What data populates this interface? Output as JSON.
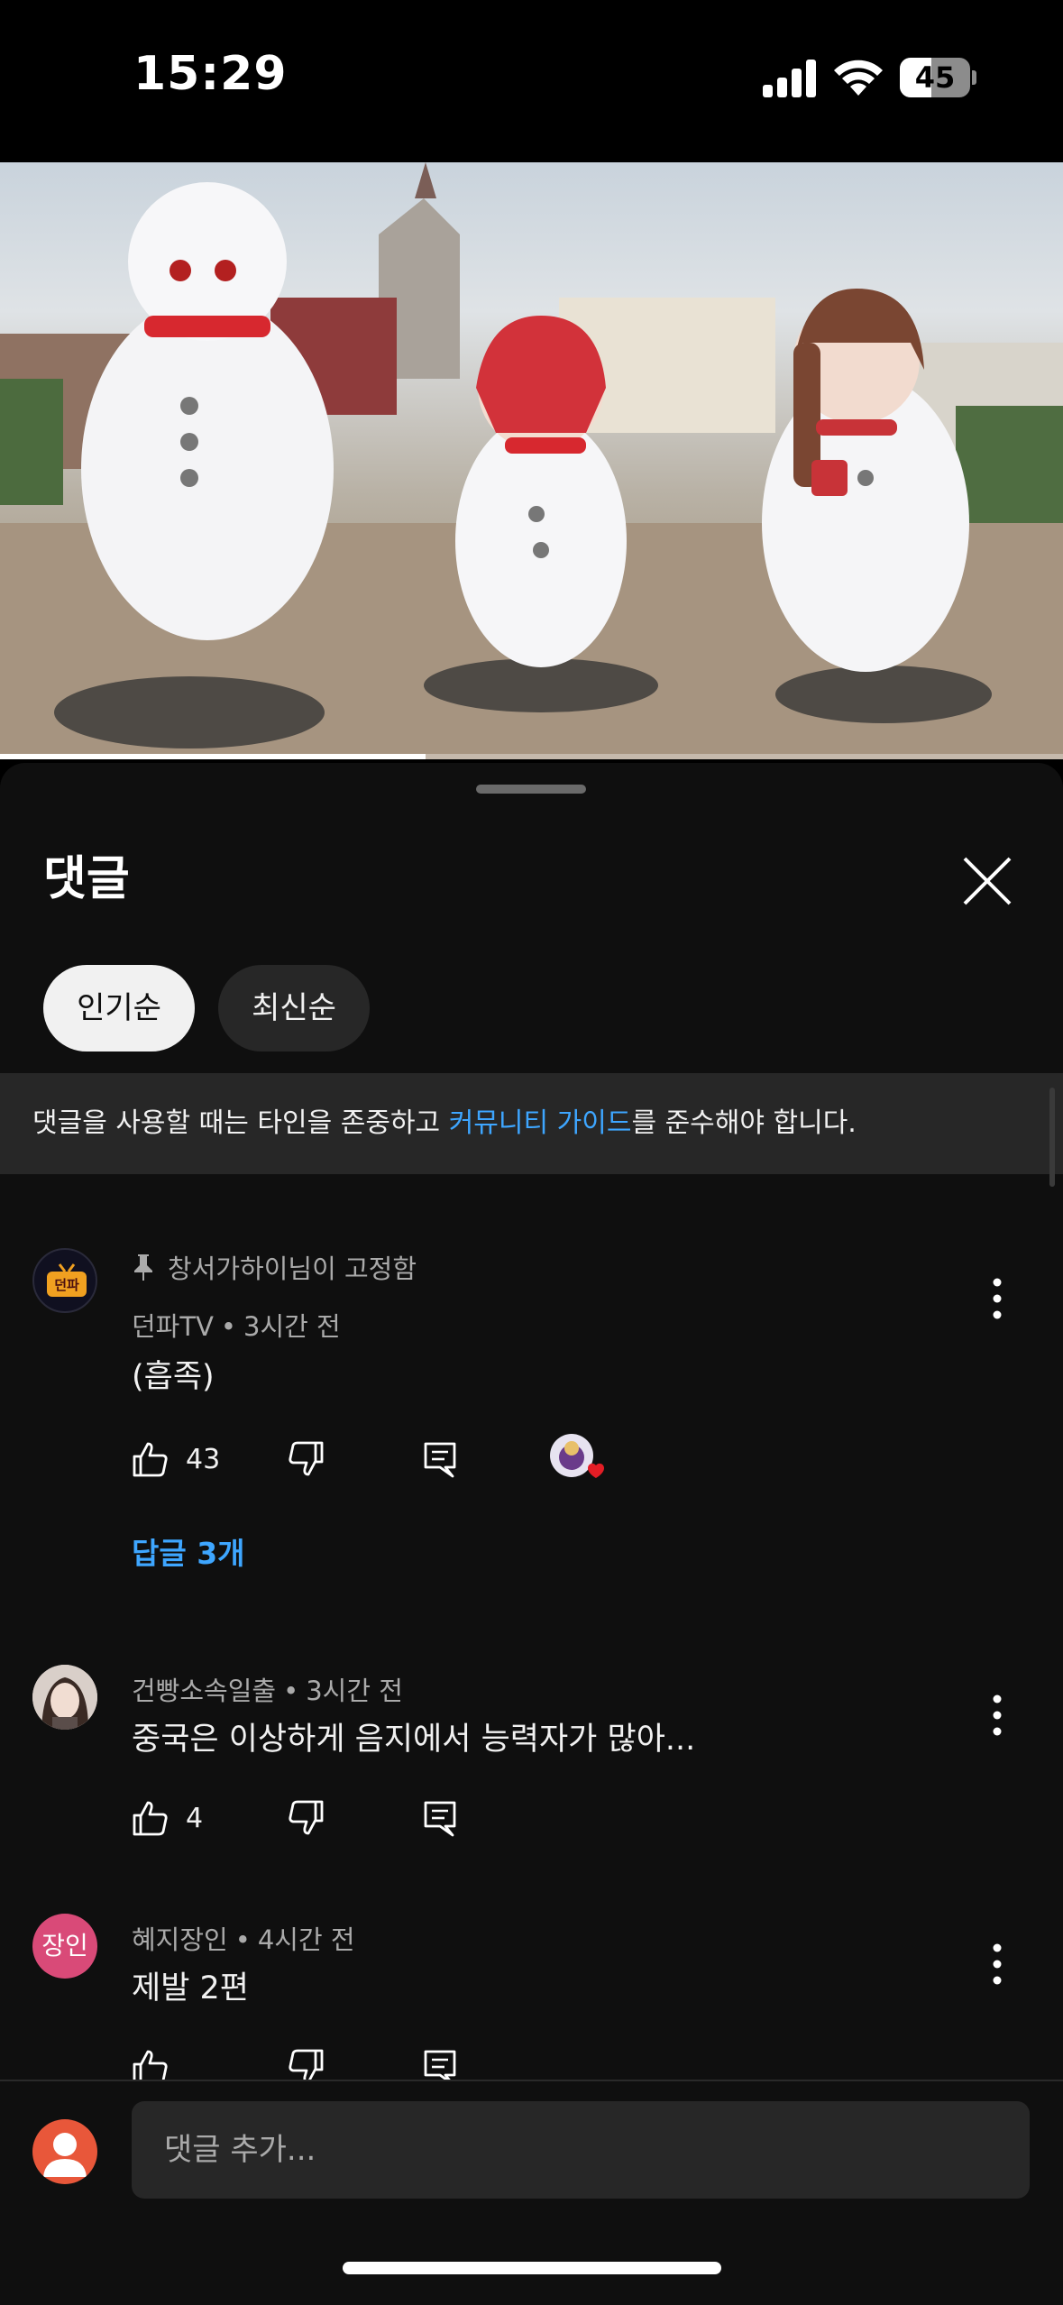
{
  "status_bar": {
    "time": "15:29",
    "battery": "45",
    "battery_level": 0.45
  },
  "video": {
    "progress": 0.4
  },
  "comments_sheet": {
    "title": "댓글",
    "sort_chips": [
      {
        "label": "인기순",
        "selected": true
      },
      {
        "label": "최신순",
        "selected": false
      }
    ],
    "notice": {
      "before": "댓글을 사용할 때는 타인을 존중하고 ",
      "link": "커뮤니티 가이드",
      "after": "를 준수해야 합니다."
    },
    "comments": [
      {
        "pinned_by": "창서가하이님이 고정함",
        "author": "던파TV",
        "time": "3시간 전",
        "text": "(흡족)",
        "likes": "43",
        "creator_heart": true,
        "replies": "답글 3개",
        "avatar_text": "던파"
      },
      {
        "author": "건빵소속일출",
        "time": "3시간 전",
        "text": "중국은 이상하게 음지에서 능력자가 많아...",
        "likes": "4"
      },
      {
        "author": "혜지장인",
        "time": "4시간 전",
        "text": "제발 2편",
        "likes": "",
        "avatar_text": "장인"
      }
    ],
    "input_placeholder": "댓글 추가..."
  },
  "colors": {
    "background": "#0f0f0f",
    "link": "#3ea6ff",
    "chip_active": "#f1f1f1",
    "chip_inactive": "#272727"
  }
}
